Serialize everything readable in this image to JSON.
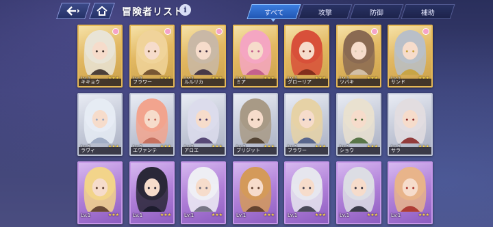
{
  "header": {
    "title": "冒険者リスト",
    "info_label": "i",
    "tabs": [
      {
        "label": "すべて",
        "active": true
      },
      {
        "label": "攻撃",
        "active": false
      },
      {
        "label": "防御",
        "active": false
      },
      {
        "label": "補助",
        "active": false
      }
    ]
  },
  "roster": [
    {
      "name": "キキョウ",
      "level": "Lv.1",
      "stars": "★★★",
      "rarity": "gold",
      "hair": "#e9e4d6",
      "accent": "#3b2f2a",
      "fav": true
    },
    {
      "name": "フラワー",
      "level": "Lv.1",
      "stars": "★★★",
      "rarity": "gold",
      "hair": "#f0d39a",
      "accent": "#6b4a2a",
      "fav": true
    },
    {
      "name": "ルルリカ",
      "level": "Lv.1",
      "stars": "★★★",
      "rarity": "gold",
      "hair": "#c9b8a6",
      "accent": "#3a2b3e",
      "fav": true
    },
    {
      "name": "ミア",
      "level": "Lv.1",
      "stars": "★★★",
      "rarity": "gold",
      "hair": "#f4a6c2",
      "accent": "#c05a8a",
      "fav": false
    },
    {
      "name": "グローリア",
      "level": "Lv.1",
      "stars": "★★★",
      "rarity": "gold",
      "hair": "#d8503a",
      "accent": "#7a2a1a",
      "fav": false
    },
    {
      "name": "ツバキ",
      "level": "Lv.1",
      "stars": "★★★",
      "rarity": "gold",
      "hair": "#8a6a52",
      "accent": "#d9c9b0",
      "fav": true
    },
    {
      "name": "サンド",
      "level": "Lv.1",
      "stars": "★★★",
      "rarity": "gold",
      "hair": "#b9bfc8",
      "accent": "#c9a23a",
      "fav": true
    },
    {
      "name": "ラヴィ",
      "level": "Lv.1",
      "stars": "★★★",
      "rarity": "silver",
      "hair": "#e6ecf4",
      "accent": "#9aa6c0",
      "fav": false
    },
    {
      "name": "エヴァンテ",
      "level": "Lv.1",
      "stars": "★★★",
      "rarity": "silver",
      "hair": "#f2a48e",
      "accent": "#c26a5a",
      "fav": false
    },
    {
      "name": "アロエ",
      "level": "Lv.1",
      "stars": "★★★",
      "rarity": "silver",
      "hair": "#dcdcec",
      "accent": "#4a3a6a",
      "fav": false
    },
    {
      "name": "ブリジット",
      "level": "Lv.1",
      "stars": "★★★",
      "rarity": "silver",
      "hair": "#a89a86",
      "accent": "#4a3a2a",
      "fav": false
    },
    {
      "name": "フラワー",
      "level": "Lv.1",
      "stars": "★★★",
      "rarity": "silver",
      "hair": "#e6d2a6",
      "accent": "#4a5a8a",
      "fav": false
    },
    {
      "name": "ショウ",
      "level": "Lv.1",
      "stars": "★★★",
      "rarity": "silver",
      "hair": "#e9e1d0",
      "accent": "#4a6a3a",
      "fav": false
    },
    {
      "name": "サラ",
      "level": "Lv.1",
      "stars": "★★★",
      "rarity": "silver",
      "hair": "#e2dde0",
      "accent": "#8a2a2a",
      "fav": false
    },
    {
      "name": "",
      "level": "Lv.1",
      "stars": "★★★",
      "rarity": "purple",
      "hair": "#f2d48a",
      "accent": "#5a3a2a",
      "fav": false
    },
    {
      "name": "",
      "level": "Lv.1",
      "stars": "★★★",
      "rarity": "purple",
      "hair": "#2a2838",
      "accent": "#1a1a2a",
      "fav": false
    },
    {
      "name": "",
      "level": "Lv.1",
      "stars": "★★★",
      "rarity": "purple",
      "hair": "#eeeef4",
      "accent": "#6a6a7a",
      "fav": false
    },
    {
      "name": "",
      "level": "Lv.1",
      "stars": "★★★",
      "rarity": "purple",
      "hair": "#d49a5a",
      "accent": "#5a3a2a",
      "fav": false
    },
    {
      "name": "",
      "level": "Lv.1",
      "stars": "★★★",
      "rarity": "purple",
      "hair": "#e6e6ee",
      "accent": "#3a3a4a",
      "fav": false
    },
    {
      "name": "",
      "level": "Lv.1",
      "stars": "★★★",
      "rarity": "purple",
      "hair": "#dcdde4",
      "accent": "#2a2a3a",
      "fav": false
    },
    {
      "name": "",
      "level": "Lv.1",
      "stars": "★★★",
      "rarity": "purple",
      "hair": "#e8b48a",
      "accent": "#a8302a",
      "fav": false
    }
  ]
}
